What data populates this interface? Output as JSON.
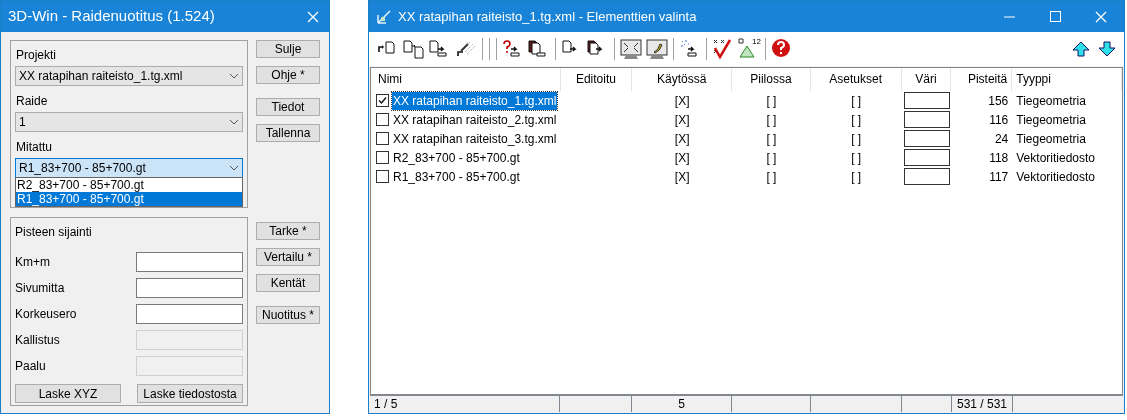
{
  "left_window": {
    "title": "3D-Win - Raidenuotitus  (1.524)",
    "selection_group": {
      "fields": [
        {
          "label": "Projekti",
          "value": "XX ratapihan raiteisto_1.tg.xml",
          "focused": false
        },
        {
          "label": "Raide",
          "value": "1",
          "focused": false
        },
        {
          "label": "Mitattu",
          "value": "R1_83+700 - 85+700.gt",
          "focused": true
        }
      ],
      "dropdown_options": [
        {
          "text": "R2_83+700 - 85+700.gt",
          "selected": false
        },
        {
          "text": "R1_83+700 - 85+700.gt",
          "selected": true
        }
      ]
    },
    "location_group": {
      "title": "Pisteen sijainti",
      "fields": [
        {
          "label": "Km+m",
          "disabled": false
        },
        {
          "label": "Sivumitta",
          "disabled": false
        },
        {
          "label": "Korkeusero",
          "disabled": false
        },
        {
          "label": "Kallistus",
          "disabled": true
        },
        {
          "label": "Paalu",
          "disabled": true
        }
      ],
      "buttons": [
        "Laske XYZ",
        "Laske tiedostosta"
      ]
    },
    "side_buttons": [
      "Sulje",
      "Ohje *",
      "Tiedot",
      "Tallenna"
    ],
    "side_buttons_lower": [
      "Tarke *",
      "Vertailu *",
      "Kentät",
      "Nuotitus *"
    ]
  },
  "right_window": {
    "title": "XX ratapihan raiteisto_1.tg.xml - Elementtien valinta",
    "toolbar": [
      {
        "kind": "new"
      },
      {
        "kind": "copy"
      },
      {
        "kind": "export"
      },
      {
        "kind": "brush"
      },
      {
        "kind": "separator"
      },
      {
        "kind": "separator"
      },
      {
        "kind": "separator"
      },
      {
        "kind": "question"
      },
      {
        "kind": "dark-export"
      },
      {
        "kind": "separator"
      },
      {
        "kind": "page-arrow"
      },
      {
        "kind": "dark-page-arrow"
      },
      {
        "kind": "separator"
      },
      {
        "kind": "fit"
      },
      {
        "kind": "monitor"
      },
      {
        "kind": "separator"
      },
      {
        "kind": "sparkle"
      },
      {
        "kind": "separator"
      },
      {
        "kind": "check"
      },
      {
        "kind": "triangle",
        "label": "12"
      },
      {
        "kind": "separator"
      },
      {
        "kind": "help"
      }
    ],
    "table": {
      "columns": [
        "Nimi",
        "Editoitu",
        "Käytössä",
        "Piilossa",
        "Asetukset",
        "Väri",
        "Pisteitä",
        "Tyyppi"
      ],
      "rows": [
        {
          "checked": true,
          "selected": true,
          "name": "XX ratapihan raiteisto_1.tg.xml",
          "in_use": "[X]",
          "hidden": "[ ]",
          "settings": "[ ]",
          "points": "156",
          "type": "Tiegeometria"
        },
        {
          "checked": false,
          "selected": false,
          "name": "XX ratapihan raiteisto_2.tg.xml",
          "in_use": "[X]",
          "hidden": "[ ]",
          "settings": "[ ]",
          "points": "116",
          "type": "Tiegeometria"
        },
        {
          "checked": false,
          "selected": false,
          "name": "XX ratapihan raiteisto_3.tg.xml",
          "in_use": "[X]",
          "hidden": "[ ]",
          "settings": "[ ]",
          "points": "24",
          "type": "Tiegeometria"
        },
        {
          "checked": false,
          "selected": false,
          "name": "R2_83+700 - 85+700.gt",
          "in_use": "[X]",
          "hidden": "[ ]",
          "settings": "[ ]",
          "points": "118",
          "type": "Vektoritiedosto"
        },
        {
          "checked": false,
          "selected": false,
          "name": "R1_83+700 - 85+700.gt",
          "in_use": "[X]",
          "hidden": "[ ]",
          "settings": "[ ]",
          "points": "117",
          "type": "Vektoritiedosto"
        }
      ]
    },
    "status_bar": {
      "count": "1 / 5",
      "in_use": "5",
      "points": "531 / 531"
    }
  }
}
